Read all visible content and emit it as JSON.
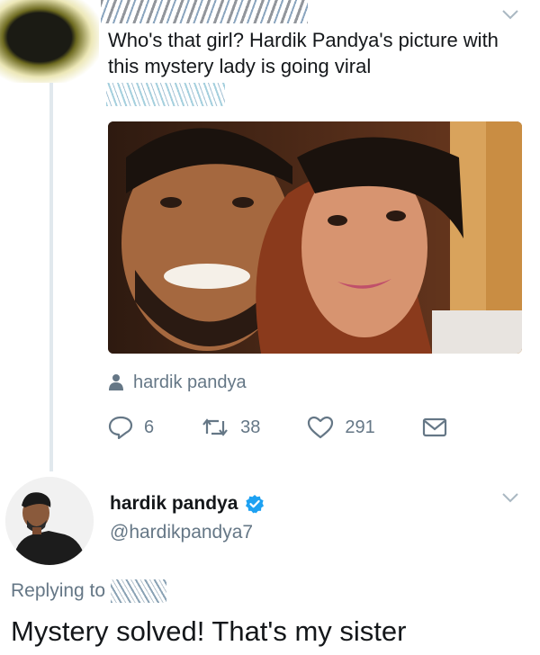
{
  "colors": {
    "primary_text": "#14171a",
    "secondary_text": "#657786",
    "verified_blue": "#1da1f2",
    "thread_line": "#e1e8ed"
  },
  "quoted_tweet": {
    "text": "Who's that girl? Hardik Pandya's picture with this mystery lady is going viral",
    "photo_tag": "hardik pandya",
    "icons": {
      "photo_tag": "person-icon",
      "reply": "reply-icon",
      "retweet": "retweet-icon",
      "like": "heart-icon",
      "message": "mail-icon",
      "menu": "chevron-down-icon"
    },
    "actions": {
      "replies": "6",
      "retweets": "38",
      "likes": "291"
    }
  },
  "reply_tweet": {
    "display_name": "hardik pandya",
    "handle": "@hardikpandya7",
    "verified": true,
    "replying_label": "Replying to",
    "text": "Mystery solved! That's my sister"
  }
}
